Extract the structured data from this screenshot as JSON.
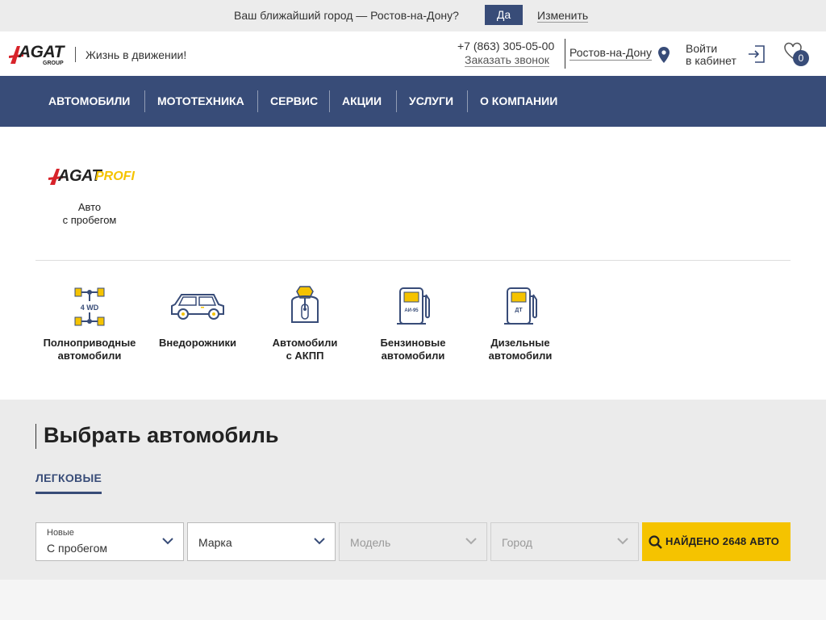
{
  "city_bar": {
    "question": "Ваш ближайший город — Ростов-на-Дону?",
    "yes_label": "Да",
    "change_label": "Изменить"
  },
  "header": {
    "logo_text": "AGAT",
    "logo_group": "GROUP",
    "slogan": "Жизнь в движении!",
    "phone": "+7 (863) 305-05-00",
    "callback": "Заказать звонок",
    "city": "Ростов-на-Дону",
    "login_line1": "Войти",
    "login_line2": "в кабинет",
    "favorites_count": "0"
  },
  "nav": {
    "items": [
      "АВТОМОБИЛИ",
      "МОТОТЕХНИКА",
      "СЕРВИС",
      "АКЦИИ",
      "УСЛУГИ",
      "О КОМПАНИИ"
    ]
  },
  "profi": {
    "logo_main": "AGAT",
    "logo_suffix": "PROFI",
    "label_line1": "Авто",
    "label_line2": "с пробегом"
  },
  "categories": [
    {
      "icon": "4wd-icon",
      "badge": "4 WD",
      "line1": "Полноприводные",
      "line2": "автомобили"
    },
    {
      "icon": "suv-icon",
      "line1": "Внедорожники",
      "line2": ""
    },
    {
      "icon": "automatic-gearbox-icon",
      "line1": "Автомобили",
      "line2": "с АКПП"
    },
    {
      "icon": "petrol-pump-icon",
      "badge": "АИ-95",
      "line1": "Бензиновые",
      "line2": "автомобили"
    },
    {
      "icon": "diesel-pump-icon",
      "badge": "ДТ",
      "line1": "Дизельные",
      "line2": "автомобили"
    }
  ],
  "select": {
    "title": "Выбрать автомобиль",
    "tab": "ЛЕГКОВЫЕ",
    "condition_small": "Новые",
    "condition_value": "С пробегом",
    "brand_placeholder": "Марка",
    "model_placeholder": "Модель",
    "city_placeholder": "Город",
    "found_label": "НАЙДЕНО 2648 АВТО"
  },
  "colors": {
    "brand_blue": "#384c78",
    "accent_yellow": "#f5c300",
    "logo_red": "#d8232a"
  }
}
